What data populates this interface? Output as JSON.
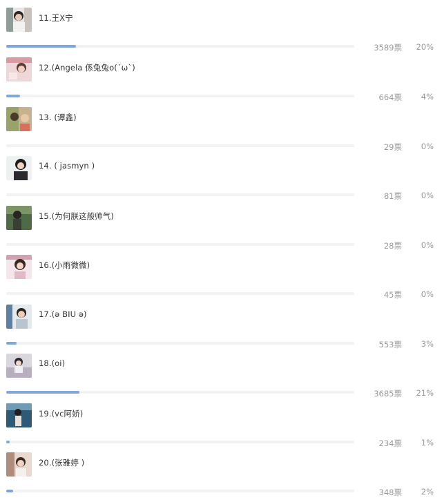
{
  "vote_list": {
    "items": [
      {
        "name": "11.王X宁",
        "votes": "3589票",
        "percent": "20%",
        "share": 0.2
      },
      {
        "name": "12.(Angela 係兔兔o(´ω`)",
        "votes": "664票",
        "percent": "4%",
        "share": 0.04
      },
      {
        "name": "13. (谭鑫)",
        "votes": "29票",
        "percent": "0%",
        "share": 0.0
      },
      {
        "name": "14. ( jasmyn )",
        "votes": "81票",
        "percent": "0%",
        "share": 0.0
      },
      {
        "name": "15.(为何朕这般帅气)",
        "votes": "28票",
        "percent": "0%",
        "share": 0.0
      },
      {
        "name": "16.(小雨微微)",
        "votes": "45票",
        "percent": "0%",
        "share": 0.0
      },
      {
        "name": "17.(ə BIU ə)",
        "votes": "553票",
        "percent": "3%",
        "share": 0.03
      },
      {
        "name": "18.(oi)",
        "votes": "3685票",
        "percent": "21%",
        "share": 0.21
      },
      {
        "name": "19.(vc阿娇)",
        "votes": "234票",
        "percent": "1%",
        "share": 0.01
      },
      {
        "name": "20.(张雅婷 )",
        "votes": "348票",
        "percent": "2%",
        "share": 0.02
      }
    ]
  },
  "colors": {
    "bar_fill": "#7fa8d8",
    "bar_track": "#f1f2f4",
    "muted_text": "#9a9a9a"
  }
}
